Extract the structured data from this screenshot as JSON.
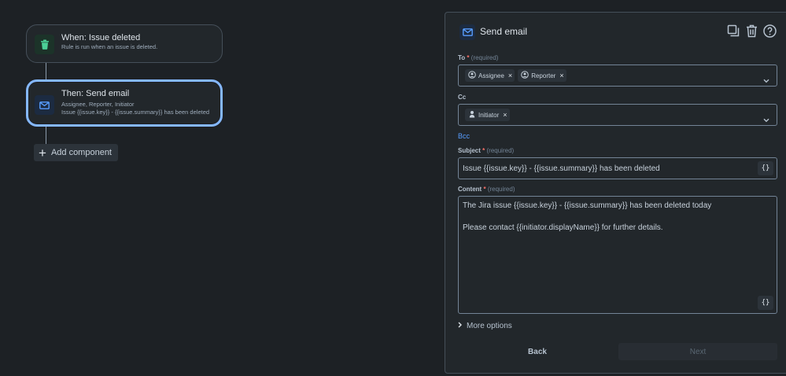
{
  "flow": {
    "trigger": {
      "title": "When: Issue deleted",
      "subtitle": "Rule is run when an issue is deleted.",
      "icon": "trash-icon",
      "color": "#22a06b"
    },
    "action": {
      "title": "Then: Send email",
      "line1": "Assignee, Reporter, Initiator",
      "line2": "Issue {{issue.key}} - {{issue.summary}} has been deleted",
      "icon": "mail-icon",
      "color": "#579dff"
    },
    "add_component_label": "Add component"
  },
  "panel": {
    "title": "Send email",
    "to": {
      "label": "To",
      "required_star": "*",
      "required_text": "(required)",
      "chips": [
        "Assignee",
        "Reporter"
      ]
    },
    "cc": {
      "label": "Cc",
      "chips": [
        "Initiator"
      ]
    },
    "bcc_label": "Bcc",
    "subject": {
      "label": "Subject",
      "required_star": "*",
      "required_text": "(required)",
      "value": "Issue {{issue.key}} - {{issue.summary}} has been deleted",
      "braces_label": "{}"
    },
    "content": {
      "label": "Content",
      "required_star": "*",
      "required_text": "(required)",
      "line1": "The Jira issue {{issue.key}} - {{issue.summary}} has been deleted today",
      "line2": "Please contact {{initiator.displayName}} for further details.",
      "braces_label": "{}"
    },
    "more_options_label": "More options",
    "back_label": "Back",
    "next_label": "Next"
  },
  "colors": {
    "background": "#1d2125",
    "accent": "#579dff",
    "selected_border": "#85b8ff",
    "required": "#f87168"
  }
}
